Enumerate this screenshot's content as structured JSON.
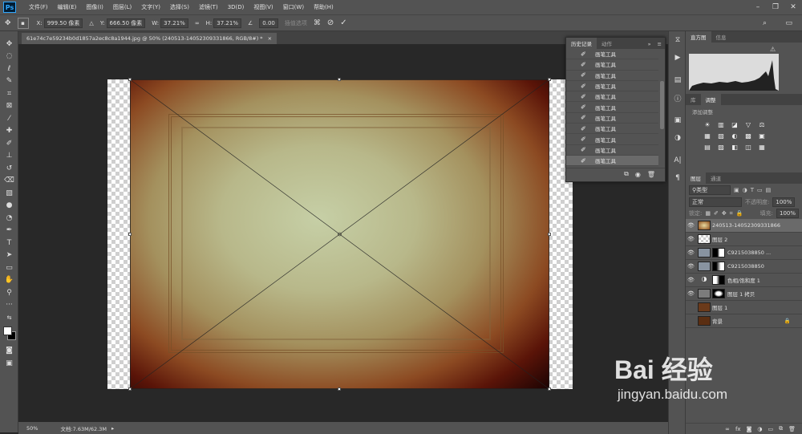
{
  "app": {
    "logo": "Ps"
  },
  "menu": [
    "文件(F)",
    "编辑(E)",
    "图像(I)",
    "图层(L)",
    "文字(Y)",
    "选择(S)",
    "滤镜(T)",
    "3D(D)",
    "视图(V)",
    "窗口(W)",
    "帮助(H)"
  ],
  "options": {
    "x_label": "X:",
    "x_value": "999.50 像素",
    "y_label": "Y:",
    "y_value": "666.50 像素",
    "w_label": "W:",
    "w_value": "37.21%",
    "h_label": "H:",
    "h_value": "37.21%",
    "angle_value": "0.00",
    "interp": "插值选项"
  },
  "document": {
    "tab_title": "61e74c7e59234b0d1857a2ec8c8a1944.jpg @ 50% (240513-14052309331866, RGB/8#) *",
    "close": "×"
  },
  "status": {
    "zoom": "50%",
    "doc": "文档:7.63M/62.3M"
  },
  "history": {
    "tabs": [
      "历史记录",
      "动作"
    ],
    "items": [
      "画笔工具",
      "画笔工具",
      "画笔工具",
      "画笔工具",
      "画笔工具",
      "画笔工具",
      "画笔工具",
      "画笔工具",
      "画笔工具",
      "画笔工具",
      "画笔工具"
    ]
  },
  "histogram": {
    "tabs": [
      "直方图",
      "信息"
    ]
  },
  "adjust": {
    "tabs": [
      "库",
      "调整"
    ],
    "title": "添加调整",
    "icons": [
      "☀",
      "▥",
      "◪",
      "▽",
      "⚖",
      "▦",
      "▧",
      "◐",
      "▩",
      "▣",
      "▤",
      "▨",
      "◧",
      "◫",
      "▦"
    ]
  },
  "layers": {
    "tabs": [
      "图层",
      "通道"
    ],
    "filter": "类型",
    "blend": "正常",
    "opacity_label": "不透明度:",
    "opacity": "100%",
    "lock_label": "锁定:",
    "fill_label": "填充:",
    "fill": "100%",
    "rows": [
      {
        "name": "240513-14052309331866",
        "active": true
      },
      {
        "name": "图层 2"
      },
      {
        "name": "C9215038850 ..."
      },
      {
        "name": "C9215038850"
      },
      {
        "name": "色相/饱和度 1"
      },
      {
        "name": "图层 1 拷贝"
      },
      {
        "name": "图层 1"
      },
      {
        "name": "背景"
      }
    ]
  },
  "watermark": {
    "brand": "Bai  经验",
    "url": "jingyan.baidu.com"
  }
}
